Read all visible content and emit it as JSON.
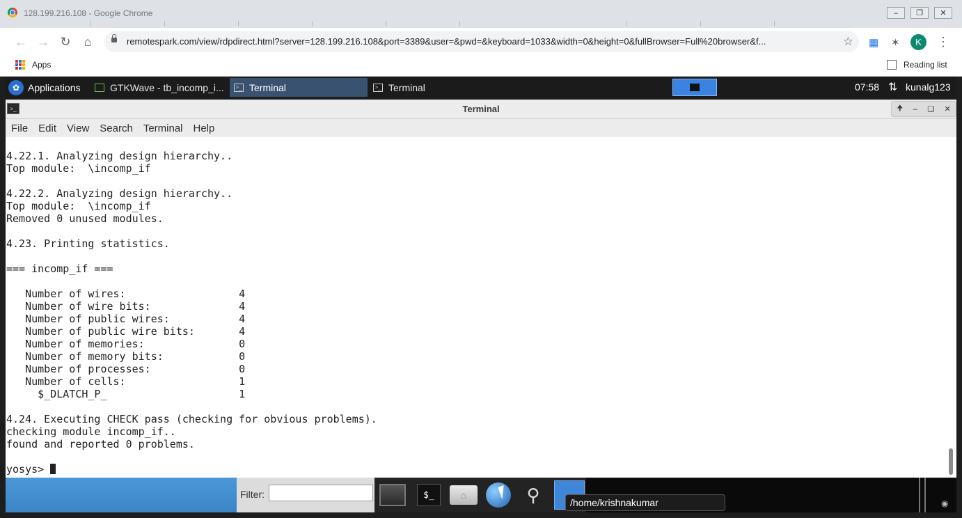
{
  "browser": {
    "window_title": "128.199.216.108 - Google Chrome",
    "url": "remotespark.com/view/rdpdirect.html?server=128.199.216.108&port=3389&user=&pwd=&keyboard=1033&width=0&height=0&fullBrowser=Full%20browser&f...",
    "avatar_letter": "K",
    "bookmarks": {
      "apps_label": "Apps",
      "reading_list_label": "Reading list"
    }
  },
  "desktop": {
    "panel": {
      "applications_label": "Applications",
      "tasks": [
        {
          "label": "GTKWave - tb_incomp_i..."
        },
        {
          "label": "Terminal"
        },
        {
          "label": "Terminal"
        }
      ],
      "clock": "07:58",
      "user": "kunalg123"
    },
    "terminal": {
      "title": "Terminal",
      "menu": [
        "File",
        "Edit",
        "View",
        "Search",
        "Terminal",
        "Help"
      ],
      "lines": [
        "4.22.1. Analyzing design hierarchy..",
        "Top module:  \\incomp_if",
        "",
        "4.22.2. Analyzing design hierarchy..",
        "Top module:  \\incomp_if",
        "Removed 0 unused modules.",
        "",
        "4.23. Printing statistics.",
        "",
        "=== incomp_if ===",
        "",
        "   Number of wires:                  4",
        "   Number of wire bits:              4",
        "   Number of public wires:           4",
        "   Number of public wire bits:       4",
        "   Number of memories:               0",
        "   Number of memory bits:            0",
        "   Number of processes:              0",
        "   Number of cells:                  1",
        "     $_DLATCH_P_                     1",
        "",
        "4.24. Executing CHECK pass (checking for obvious problems).",
        "checking module incomp_if..",
        "found and reported 0 problems.",
        ""
      ],
      "prompt": "yosys> "
    },
    "dock": {
      "filter_label": "Filter:",
      "filter_value": "",
      "tooltip": "/home/krishnakumar"
    }
  },
  "colors": {
    "panel_bg": "#1b1b1b",
    "active_task": "#39526f",
    "workspace_active": "#3b83e0",
    "dock_blue": "#3c85c6"
  }
}
